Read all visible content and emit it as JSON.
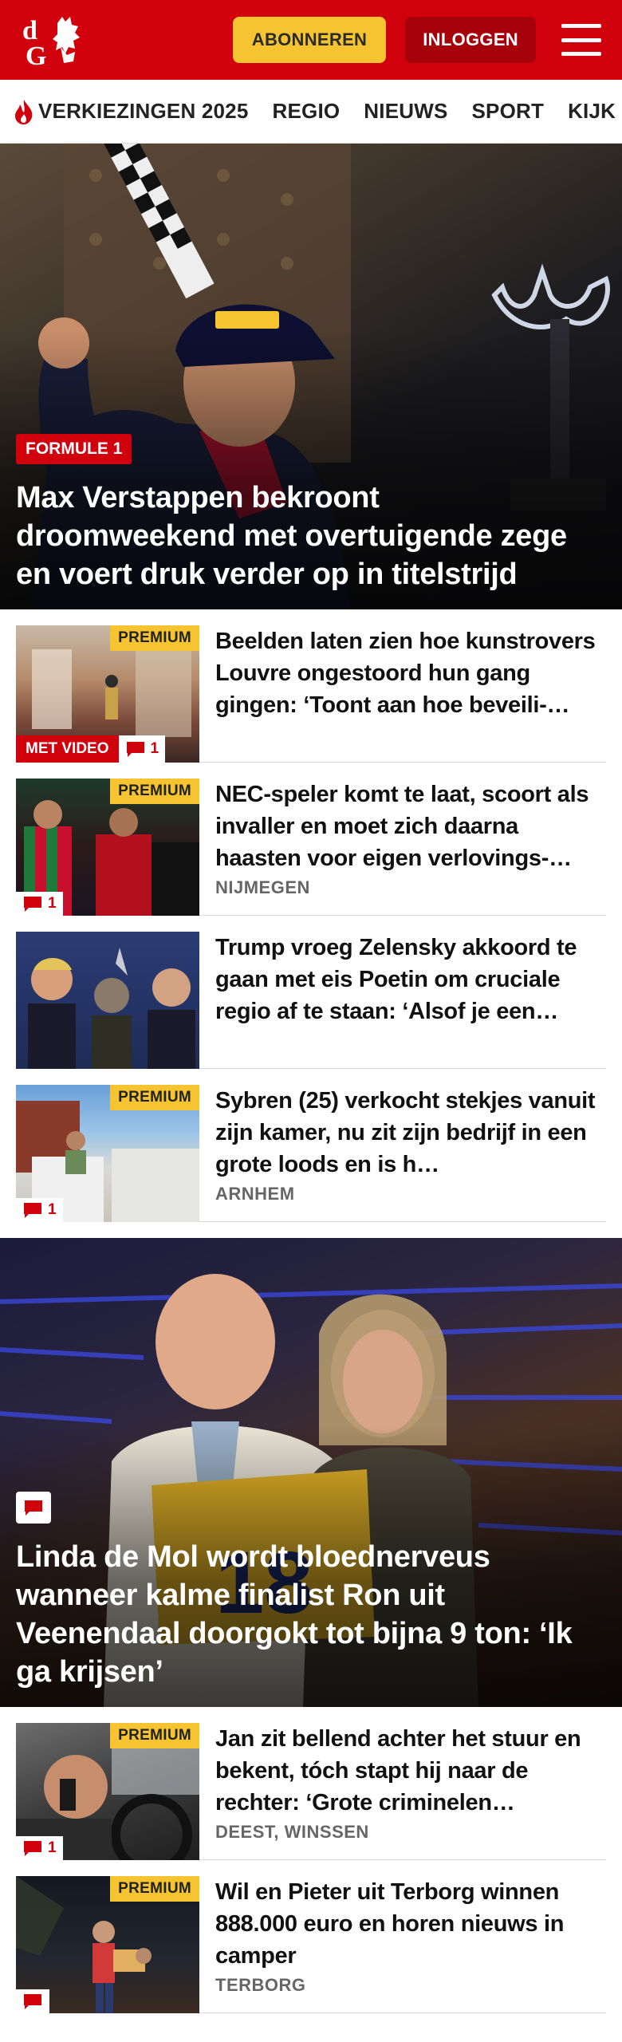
{
  "header": {
    "subscribe_label": "ABONNEREN",
    "login_label": "INLOGGEN",
    "brand_color": "#d0000d",
    "subscribe_color": "#f6c431"
  },
  "nav": {
    "items": [
      "VERKIEZINGEN 2025",
      "REGIO",
      "NIEUWS",
      "SPORT",
      "KIJK"
    ]
  },
  "hero1": {
    "tag": "FORMULE 1",
    "title": "Max Verstappen bekroont droomweekend met overtuigende zege en voert druk verder op in titel­strijd"
  },
  "articles_a": [
    {
      "title": "Beelden laten zien hoe kunstro­vers Louvre ongestoord hun gang gingen: ‘Toont aan hoe beveili-…",
      "premium": "PREMIUM",
      "video": "MET VIDEO",
      "comments": "1",
      "location": ""
    },
    {
      "title": "NEC-speler komt te laat, scoort als invaller en moet zich daarna haasten voor eigen verlovings-…",
      "premium": "PREMIUM",
      "comments": "1",
      "location": "NIJMEGEN"
    },
    {
      "title": "Trump vroeg Zelensky akkoord te gaan met eis Poetin om cruciale regio af te staan: ‘Alsof je een…",
      "location": ""
    },
    {
      "title": "Sybren (25) verkocht stekjes vanuit zijn kamer, nu zit zijn bedrijf in een grote loods en is h…",
      "premium": "PREMIUM",
      "comments": "1",
      "location": "ARNHEM"
    }
  ],
  "hero2": {
    "title": "Linda de Mol wordt bloednerveus wanneer kalme finalist Ron uit Veenendaal doorgokt tot bijna 9 ton: ‘Ik ga krijsen’",
    "podium_number": "18"
  },
  "articles_b": [
    {
      "title": "Jan zit bellend achter het stuur en bekent, tóch stapt hij naar de rechter: ‘Grote criminelen…",
      "premium": "PREMIUM",
      "comments": "1",
      "location": "DEEST, WINSSEN"
    },
    {
      "title": "Wil en Pieter uit Terborg winnen 888.000 euro en horen nieuws in camper",
      "premium": "PREMIUM",
      "location": "TERBORG"
    }
  ]
}
